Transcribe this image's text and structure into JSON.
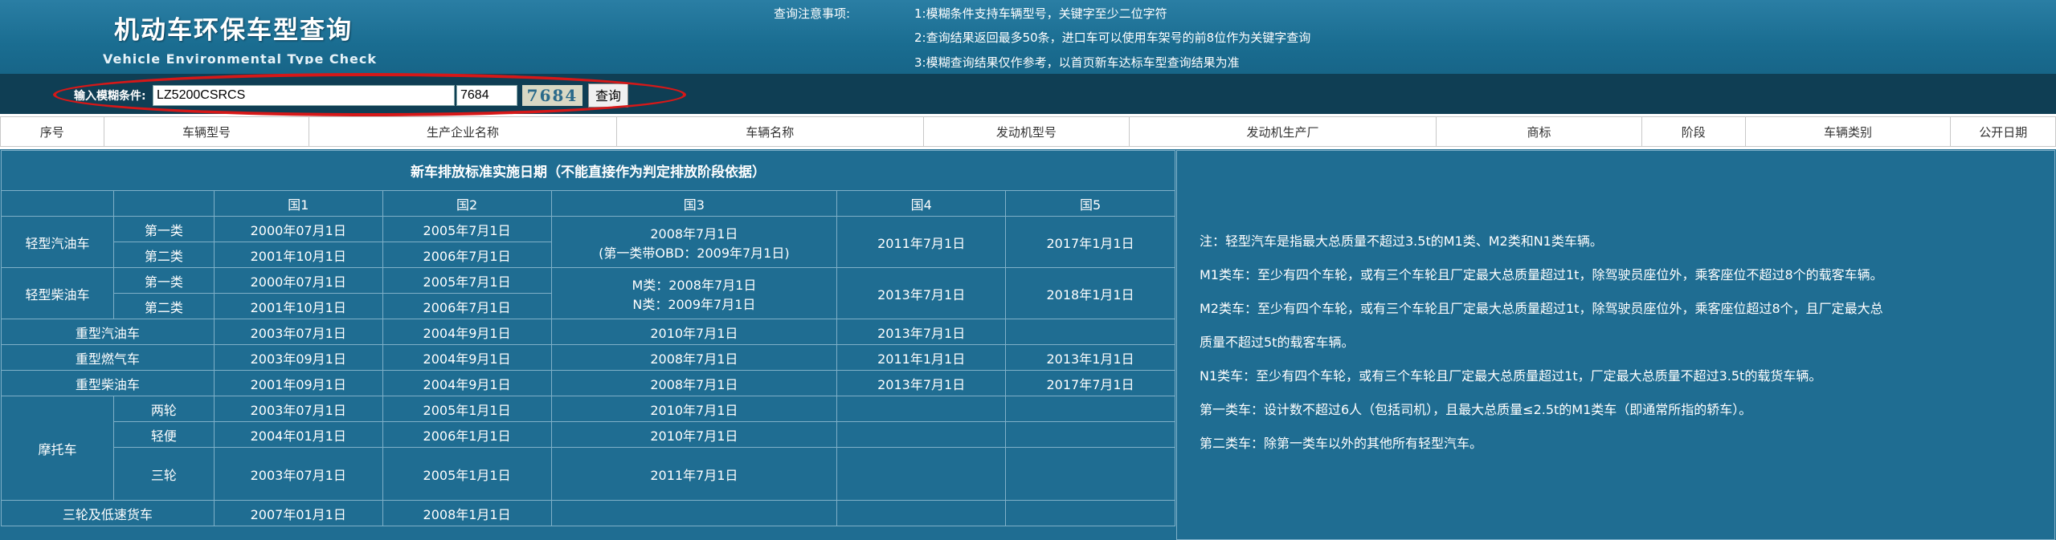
{
  "header": {
    "title": "机动车环保车型查询",
    "subtitle": "Vehicle Environmental Type Check",
    "notice_label": "查询注意事项:",
    "notices": [
      "1:模糊条件支持车辆型号，关键字至少二位字符",
      "2:查询结果返回最多50条，进口车可以使用车架号的前8位作为关键字查询",
      "3:模糊查询结果仅作参考，以首页新车达标车型查询结果为准"
    ]
  },
  "search": {
    "label": "输入模糊条件:",
    "keyword_value": "LZ5200CSRCS",
    "captcha_input_value": "7684",
    "captcha_image_text": "7684",
    "button_label": "查询",
    "highlight_color": "#d61818"
  },
  "results_table": {
    "columns": [
      "序号",
      "车辆型号",
      "生产企业名称",
      "车辆名称",
      "发动机型号",
      "发动机生产厂",
      "商标",
      "阶段",
      "车辆类别",
      "公开日期"
    ]
  },
  "standards": {
    "title": "新车排放标准实施日期（不能直接作为判定排放阶段依据）",
    "stage_headers": [
      "国1",
      "国2",
      "国3",
      "国4",
      "国5"
    ],
    "light_gas": {
      "label": "轻型汽油车",
      "class1": "第一类",
      "class2": "第二类",
      "c1_g1": "2000年07月1日",
      "c1_g2": "2005年7月1日",
      "c2_g1": "2001年10月1日",
      "c2_g2": "2006年7月1日",
      "g3_line1": "2008年7月1日",
      "g3_line2": "(第一类带OBD：2009年7月1日)",
      "g4": "2011年7月1日",
      "g5": "2017年1月1日"
    },
    "light_diesel": {
      "label": "轻型柴油车",
      "class1": "第一类",
      "class2": "第二类",
      "c1_g1": "2000年07月1日",
      "c1_g2": "2005年7月1日",
      "c2_g1": "2001年10月1日",
      "c2_g2": "2006年7月1日",
      "g3_line1": "M类：2008年7月1日",
      "g3_line2": "N类：2009年7月1日",
      "g4": "2013年7月1日",
      "g5": "2018年1月1日"
    },
    "heavy_gas": {
      "label": "重型汽油车",
      "g1": "2003年07月1日",
      "g2": "2004年9月1日",
      "g3": "2010年7月1日",
      "g4": "2013年7月1日",
      "g5": ""
    },
    "heavy_fuel_gas": {
      "label": "重型燃气车",
      "g1": "2003年09月1日",
      "g2": "2004年9月1日",
      "g3": "2008年7月1日",
      "g4": "2011年1月1日",
      "g5": "2013年1月1日"
    },
    "heavy_diesel": {
      "label": "重型柴油车",
      "g1": "2001年09月1日",
      "g2": "2004年9月1日",
      "g3": "2008年7月1日",
      "g4": "2013年7月1日",
      "g5": "2017年7月1日"
    },
    "motorcycle": {
      "label": "摩托车",
      "two_wheel": {
        "label": "两轮",
        "g1": "2003年07月1日",
        "g2": "2005年1月1日",
        "g3": "2010年7月1日"
      },
      "light": {
        "label": "轻便",
        "g1": "2004年01月1日",
        "g2": "2006年1月1日",
        "g3": "2010年7月1日"
      },
      "three_wheel": {
        "label": "三轮",
        "g1": "2003年07月1日",
        "g2": "2005年1月1日",
        "g3": "2011年7月1日"
      }
    },
    "tricycle_low_speed": {
      "label": "三轮及低速货车",
      "g1": "2007年01月1日",
      "g2": "2008年1月1日"
    }
  },
  "notes": [
    "注：轻型汽车是指最大总质量不超过3.5t的M1类、M2类和N1类车辆。",
    "M1类车：至少有四个车轮，或有三个车轮且厂定最大总质量超过1t，除驾驶员座位外，乘客座位不超过8个的载客车辆。",
    "M2类车：至少有四个车轮，或有三个车轮且厂定最大总质量超过1t，除驾驶员座位外，乘客座位超过8个，且厂定最大总",
    "质量不超过5t的载客车辆。",
    "N1类车：至少有四个车轮，或有三个车轮且厂定最大总质量超过1t，厂定最大总质量不超过3.5t的载货车辆。",
    "第一类车：设计数不超过6人（包括司机），且最大总质量≤2.5t的M1类车（即通常所指的轿车）。",
    "第二类车：除第一类车以外的其他所有轻型汽车。"
  ]
}
